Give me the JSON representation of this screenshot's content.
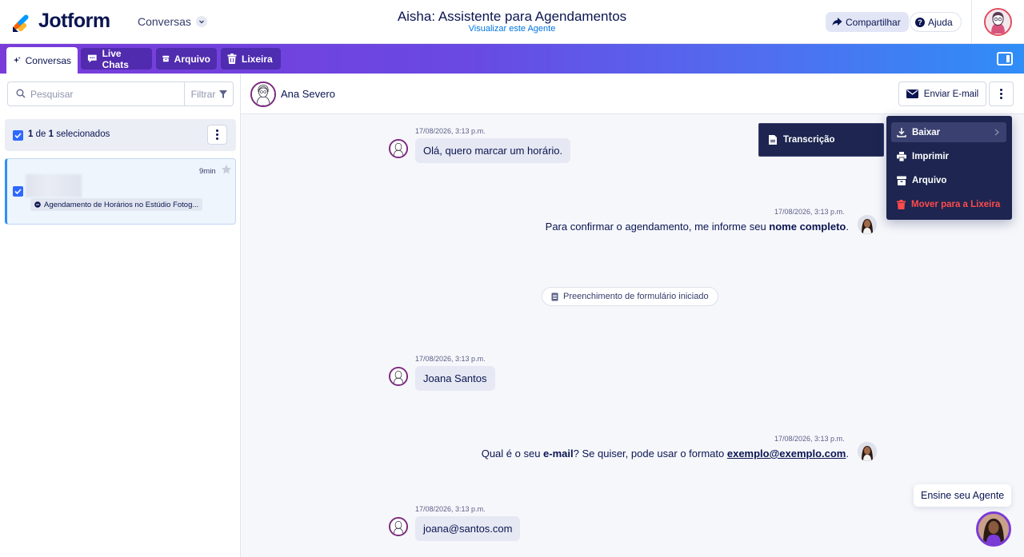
{
  "header": {
    "logo_text": "Jotform",
    "app_switch_label": "Conversas",
    "agent_title": "Aisha: Assistente para Agendamentos",
    "agent_link": "Visualizar este Agente",
    "share_label": "Compartilhar",
    "help_label": "Ajuda"
  },
  "tabs": [
    {
      "label": "Conversas",
      "icon": "sparkle-icon",
      "active": true
    },
    {
      "label": "Live Chats",
      "icon": "chat-icon"
    },
    {
      "label": "Arquivo",
      "icon": "archive-icon"
    },
    {
      "label": "Lixeira",
      "icon": "trash-icon"
    }
  ],
  "sidebar": {
    "search_placeholder": "Pesquisar",
    "filter_label": "Filtrar",
    "selection": {
      "count": "1",
      "of": "de",
      "total": "1",
      "suffix": "selecionados"
    },
    "conversation": {
      "time": "9min",
      "form_name": "Agendamento de Horários no Estúdio Fotog..."
    }
  },
  "chat": {
    "contact_name": "Ana Severo",
    "email_button": "Enviar E-mail",
    "messages": [
      {
        "time": "17/08/2026, 3:13 p.m.",
        "text": "Olá, quero marcar um horário."
      },
      {
        "time": "17/08/2026, 3:13 p.m.",
        "text_before": "Para confirmar o agendamento, me informe seu ",
        "bold": "nome completo",
        "text_after": "."
      },
      {
        "event": "Preenchimento de formulário iniciado"
      },
      {
        "time": "17/08/2026, 3:13 p.m.",
        "text": "Joana Santos"
      },
      {
        "time": "17/08/2026, 3:13 p.m.",
        "text_before": "Qual é o seu ",
        "bold": "e-mail",
        "text_mid": "? Se quiser, pode usar o formato ",
        "link": "exemplo@exemplo.com",
        "text_after": "."
      },
      {
        "time": "17/08/2026, 3:13 p.m.",
        "text": "joana@santos.com"
      }
    ]
  },
  "menu": {
    "submenu_item": "Transcrição",
    "items": [
      "Baixar",
      "Imprimir",
      "Arquivo",
      "Mover para a Lixeira"
    ]
  },
  "teach_agent_label": "Ensine seu Agente",
  "colors": {
    "brand_navy": "#0a1551",
    "accent_blue": "#2e69ff",
    "danger": "#ff4b4b",
    "menu_bg": "#1d2550"
  }
}
